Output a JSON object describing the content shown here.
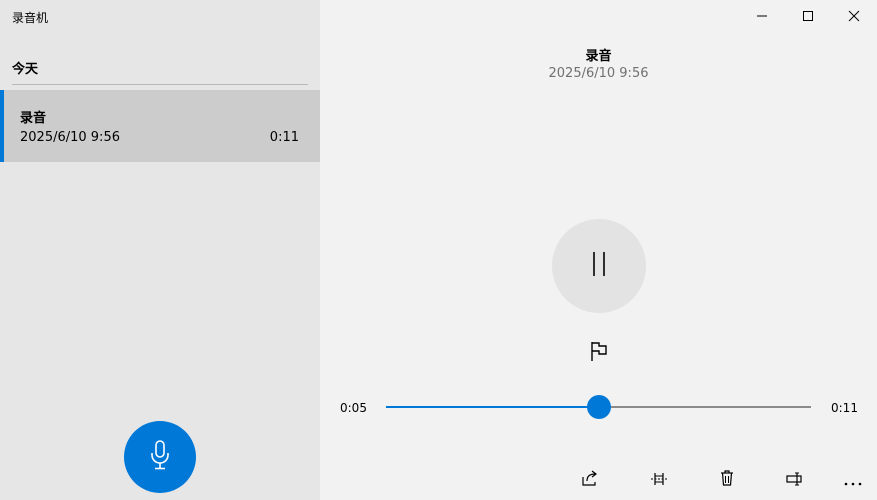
{
  "app": {
    "title": "录音机"
  },
  "sidebar": {
    "section_header": "今天",
    "recordings": [
      {
        "name": "录音",
        "date": "2025/6/10 9:56",
        "duration": "0:11"
      }
    ],
    "record_button_icon": "microphone-icon"
  },
  "window_controls": [
    "minimize-icon",
    "maximize-icon",
    "close-icon"
  ],
  "header": {
    "title": "录音",
    "date": "2025/6/10 9:56"
  },
  "player": {
    "pause_icon": "pause-icon",
    "flag_icon": "flag-icon",
    "current_time": "0:05",
    "total_time": "0:11",
    "progress_fraction": 0.5
  },
  "toolbar": [
    "share-icon",
    "trim-icon",
    "delete-icon",
    "rename-icon",
    "more-icon"
  ],
  "colors": {
    "accent": "#0078d7",
    "sidebar_bg": "#e6e6e6",
    "selected_bg": "#cccccc",
    "main_bg": "#f2f2f2"
  }
}
